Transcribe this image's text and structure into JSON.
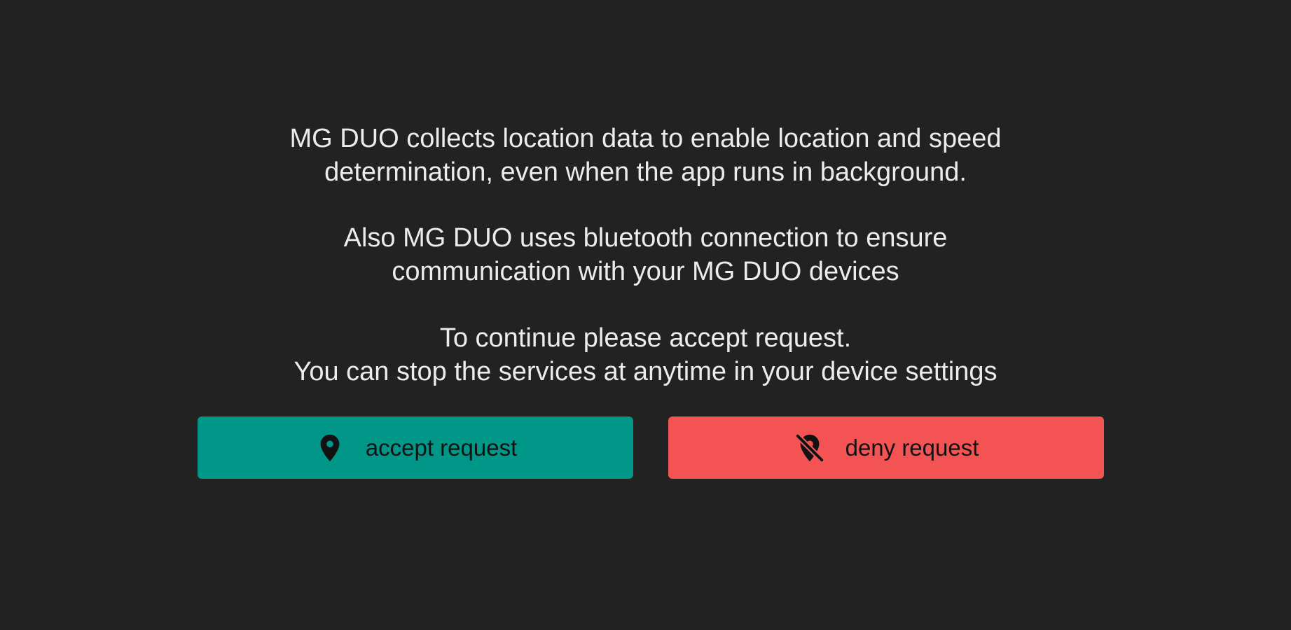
{
  "dialog": {
    "paragraph_1": {
      "line_1": "MG DUO collects location data to enable location and speed",
      "line_2": "determination, even when the app runs in background."
    },
    "paragraph_2": {
      "line_1": "Also MG DUO uses bluetooth connection to ensure",
      "line_2": "communication with your MG DUO devices"
    },
    "paragraph_3": {
      "line_1": "To continue please accept request.",
      "line_2": "You can stop the services at anytime in your device settings"
    }
  },
  "buttons": {
    "accept": {
      "label": "accept request",
      "icon": "location-pin-icon",
      "color": "#009688"
    },
    "deny": {
      "label": "deny request",
      "icon": "location-off-icon",
      "color": "#f45353"
    }
  },
  "colors": {
    "background": "#222222",
    "text": "#ececec"
  }
}
